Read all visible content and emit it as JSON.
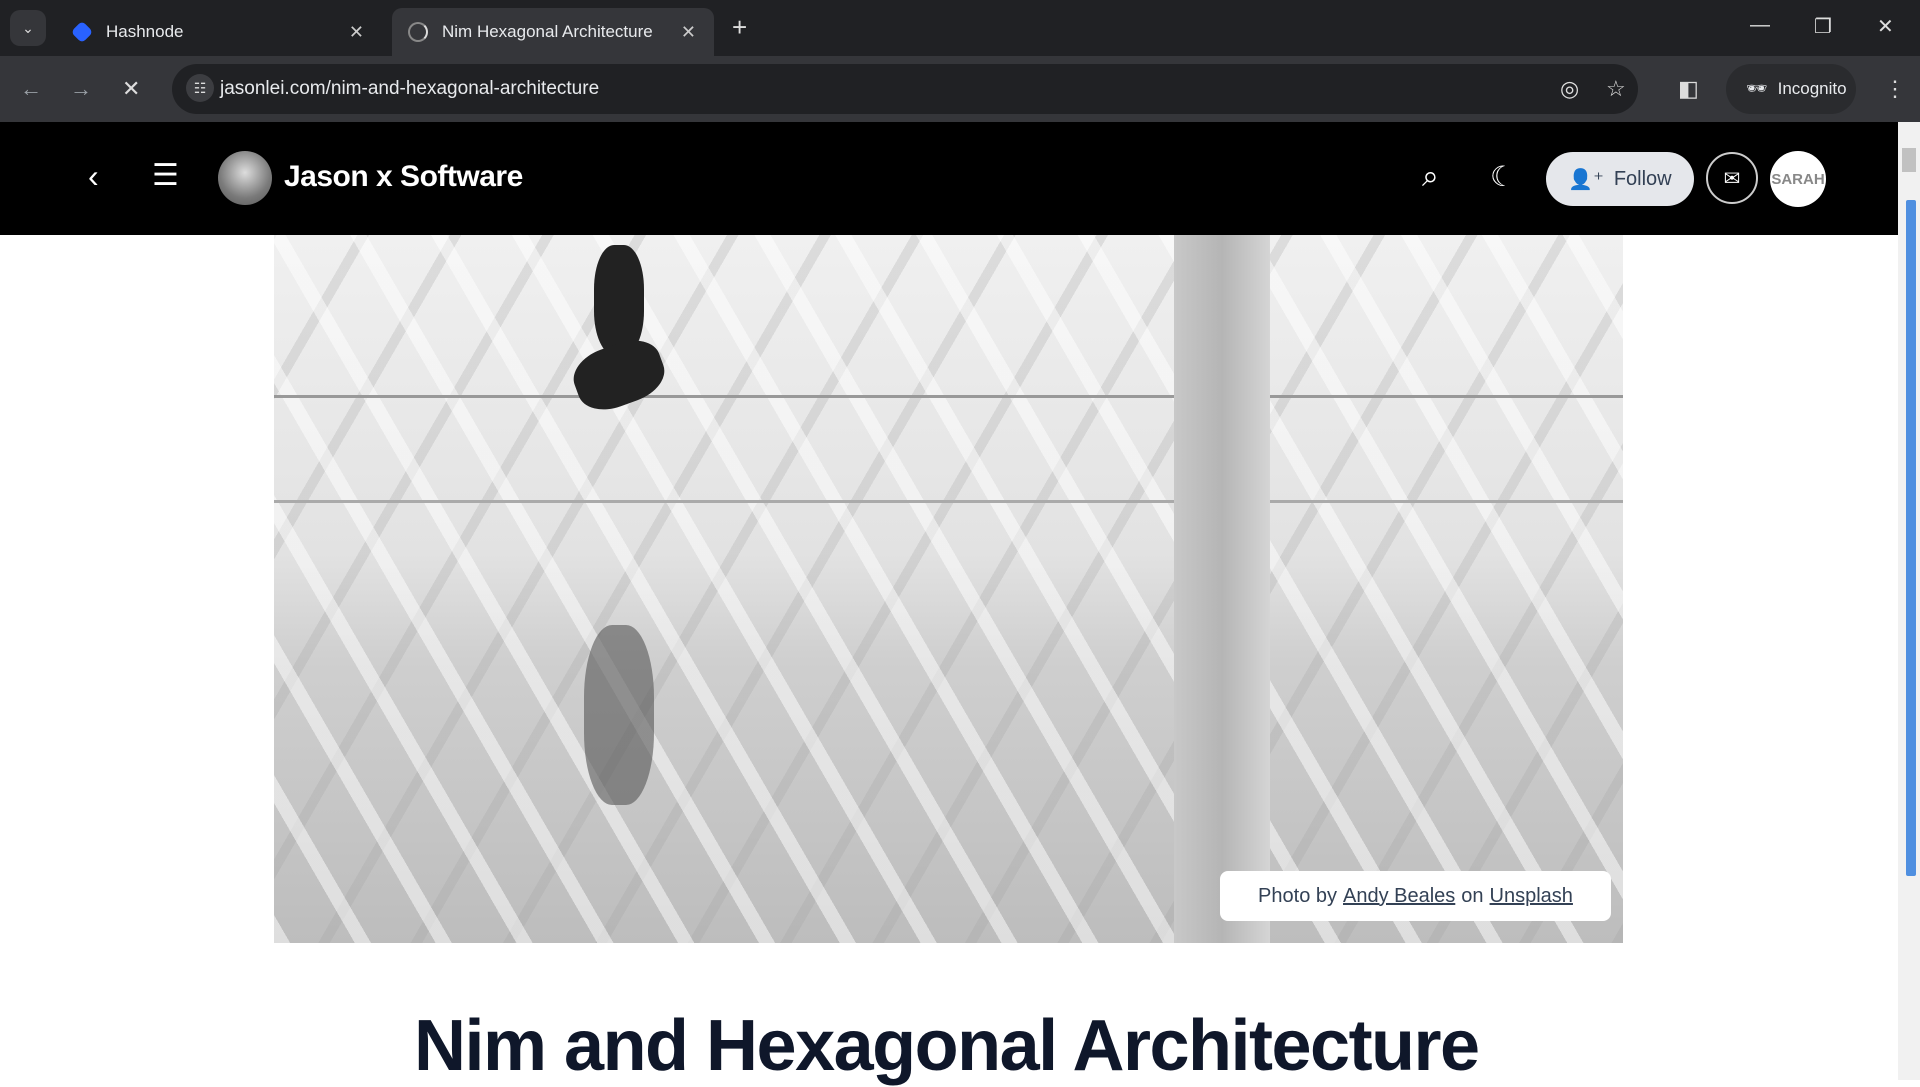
{
  "browser": {
    "tabs": [
      {
        "title": "Hashnode",
        "active": false
      },
      {
        "title": "Nim Hexagonal Architecture",
        "active": true
      }
    ],
    "url": "jasonlei.com/nim-and-hexagonal-architecture",
    "incognito_label": "Incognito",
    "accent": "#3b82f6"
  },
  "header": {
    "brand": "Jason x Software",
    "follow_label": "Follow",
    "user_avatar_text": "SARAH"
  },
  "hero": {
    "caption_prefix": "Photo by",
    "photographer": "Andy Beales",
    "caption_mid": "on",
    "source": "Unsplash"
  },
  "article": {
    "title": "Nim and Hexagonal Architecture"
  }
}
